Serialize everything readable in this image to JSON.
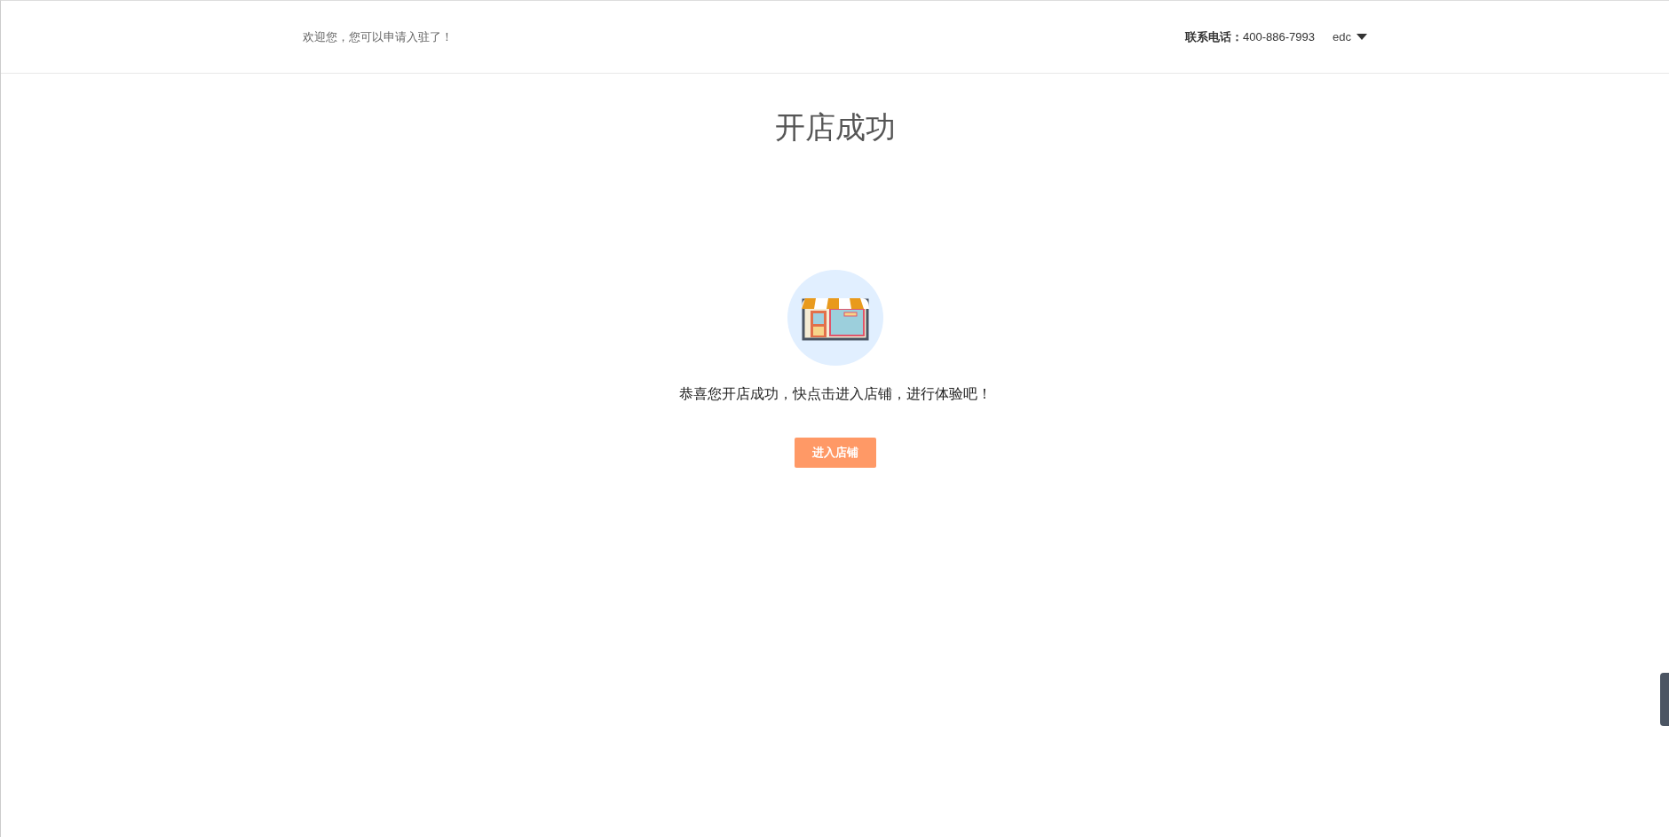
{
  "header": {
    "welcome": "欢迎您，您可以申请入驻了！",
    "phone_label": "联系电话：",
    "phone": "400-886-7993",
    "user": "edc"
  },
  "title": "开店成功",
  "message": "恭喜您开店成功，快点击进入店铺，进行体验吧！",
  "button": "进入店铺"
}
